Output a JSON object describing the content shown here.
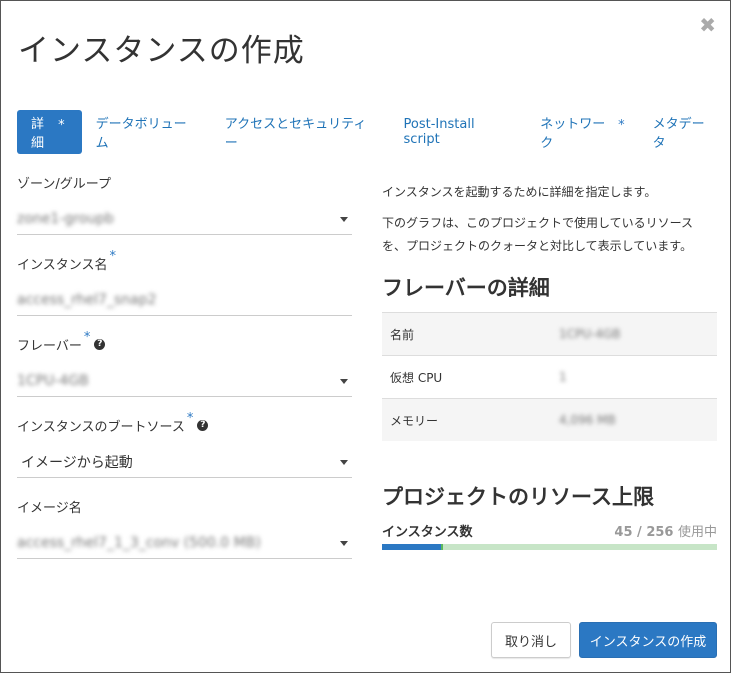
{
  "dialog": {
    "title": "インスタンスの作成",
    "close_icon": "close-icon"
  },
  "tabs": [
    {
      "label": "詳細",
      "required": "*",
      "active": true
    },
    {
      "label": "データボリューム",
      "required": ""
    },
    {
      "label": "アクセスとセキュリティー",
      "required": ""
    },
    {
      "label": "Post-Install script",
      "required": ""
    },
    {
      "label": "ネットワーク",
      "required": "*"
    },
    {
      "label": "メタデータ",
      "required": ""
    }
  ],
  "form": {
    "zone": {
      "label": "ゾーン/グループ",
      "value": "zone1-groupb"
    },
    "instance_name": {
      "label": "インスタンス名",
      "required": "*",
      "value": "access_rhel7_snap2"
    },
    "flavor": {
      "label": "フレーバー",
      "required": "*",
      "help": "?",
      "value": "1CPU-4GB"
    },
    "boot_source": {
      "label": "インスタンスのブートソース",
      "required": "*",
      "help": "?",
      "value": "イメージから起動"
    },
    "image_name": {
      "label": "イメージ名",
      "value": "access_rhel7_1_3_conv (500.0 MB)"
    }
  },
  "info": {
    "desc1": "インスタンスを起動するために詳細を指定します。",
    "desc2": "下のグラフは、このプロジェクトで使用しているリソースを、プロジェクトのクォータと対比して表示しています。",
    "flavor_heading": "フレーバーの詳細",
    "flavor_rows": [
      {
        "key": "名前",
        "value": "1CPU-4GB"
      },
      {
        "key": "仮想 CPU",
        "value": "1"
      },
      {
        "key": "メモリー",
        "value": "4,096 MB"
      }
    ],
    "quota_heading": "プロジェクトのリソース上限",
    "quota": {
      "name": "インスタンス数",
      "used": "45 / 256",
      "suffix": "使用中",
      "fraction": 0.176
    }
  },
  "buttons": {
    "cancel": "取り消し",
    "create": "インスタンスの作成"
  }
}
